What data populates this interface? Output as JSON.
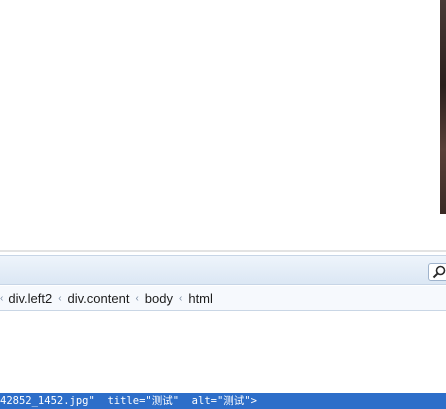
{
  "breadcrumb": {
    "items": [
      {
        "label": "div.left2"
      },
      {
        "label": "div.content"
      },
      {
        "label": "body"
      },
      {
        "label": "html"
      }
    ]
  },
  "status_bar": {
    "text": "42852_1452.jpg\"  title=\"测试\"  alt=\"测试\">"
  },
  "icons": {
    "search": "search-icon",
    "chevron": "chevron-left-icon"
  },
  "colors": {
    "status_bar_bg": "#2d6ec9",
    "toolbar_bg": "#dbe7f4"
  }
}
